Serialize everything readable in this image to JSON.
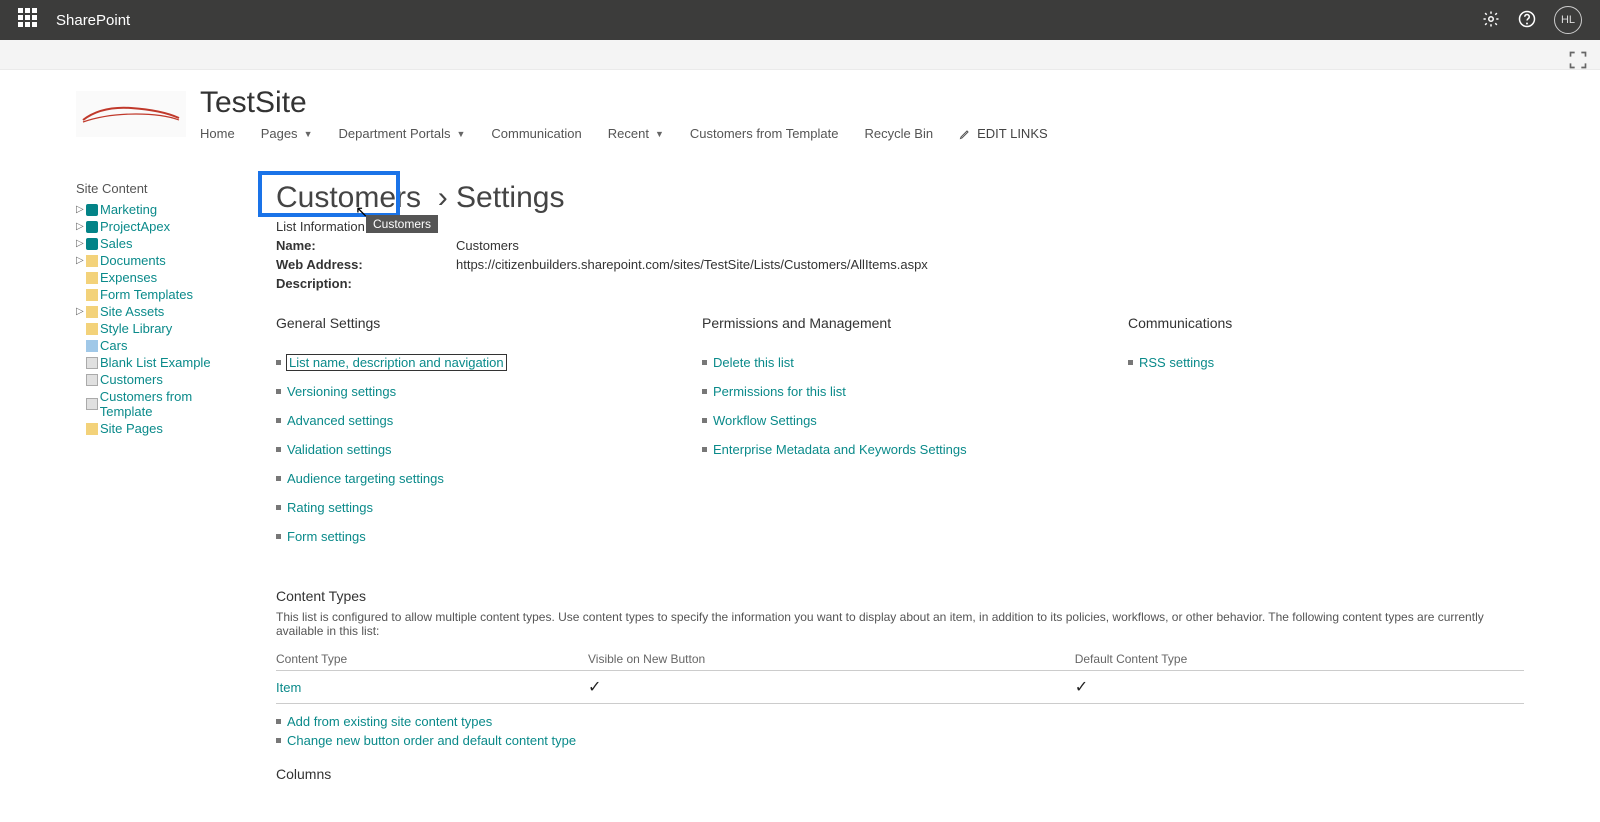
{
  "topbar": {
    "product": "SharePoint",
    "avatar_initials": "HL"
  },
  "site": {
    "title": "TestSite"
  },
  "topnav": {
    "items": [
      {
        "label": "Home",
        "dropdown": false
      },
      {
        "label": "Pages",
        "dropdown": true
      },
      {
        "label": "Department Portals",
        "dropdown": true
      },
      {
        "label": "Communication",
        "dropdown": false
      },
      {
        "label": "Recent",
        "dropdown": true
      },
      {
        "label": "Customers from Template",
        "dropdown": false
      },
      {
        "label": "Recycle Bin",
        "dropdown": false
      }
    ],
    "edit_links": "EDIT LINKS"
  },
  "leftnav": {
    "title": "Site Content",
    "items": [
      {
        "label": "Marketing",
        "icon": "sp",
        "expandable": true
      },
      {
        "label": "ProjectApex",
        "icon": "sp",
        "expandable": true
      },
      {
        "label": "Sales",
        "icon": "sp",
        "expandable": true
      },
      {
        "label": "Documents",
        "icon": "folder",
        "expandable": true
      },
      {
        "label": "Expenses",
        "icon": "lib",
        "expandable": false
      },
      {
        "label": "Form Templates",
        "icon": "lib",
        "expandable": false
      },
      {
        "label": "Site Assets",
        "icon": "lib",
        "expandable": true
      },
      {
        "label": "Style Library",
        "icon": "lib",
        "expandable": false
      },
      {
        "label": "Cars",
        "icon": "img",
        "expandable": false
      },
      {
        "label": "Blank List Example",
        "icon": "list",
        "expandable": false
      },
      {
        "label": "Customers",
        "icon": "list",
        "expandable": false
      },
      {
        "label": "Customers from Template",
        "icon": "list",
        "expandable": false
      },
      {
        "label": "Site Pages",
        "icon": "lib",
        "expandable": false
      }
    ]
  },
  "page": {
    "heading_link": "Customers",
    "heading_suffix": "Settings",
    "tooltip": "Customers",
    "list_info_label": "List Information",
    "name_label": "Name:",
    "name_value": "Customers",
    "web_label": "Web Address:",
    "web_value": "https://citizenbuilders.sharepoint.com/sites/TestSite/Lists/Customers/AllItems.aspx",
    "desc_label": "Description:"
  },
  "settings_groups": {
    "general": {
      "title": "General Settings",
      "links": [
        "List name, description and navigation",
        "Versioning settings",
        "Advanced settings",
        "Validation settings",
        "Audience targeting settings",
        "Rating settings",
        "Form settings"
      ]
    },
    "permissions": {
      "title": "Permissions and Management",
      "links": [
        "Delete this list",
        "Permissions for this list",
        "Workflow Settings",
        "Enterprise Metadata and Keywords Settings"
      ]
    },
    "communications": {
      "title": "Communications",
      "links": [
        "RSS settings"
      ]
    }
  },
  "content_types": {
    "title": "Content Types",
    "description": "This list is configured to allow multiple content types. Use content types to specify the information you want to display about an item, in addition to its policies, workflows, or other behavior. The following content types are currently available in this list:",
    "columns": {
      "type": "Content Type",
      "visible": "Visible on New Button",
      "default": "Default Content Type"
    },
    "rows": [
      {
        "name": "Item",
        "visible": true,
        "default": true
      }
    ],
    "add_link": "Add from existing site content types",
    "order_link": "Change new button order and default content type"
  },
  "columns_section": {
    "title": "Columns"
  }
}
